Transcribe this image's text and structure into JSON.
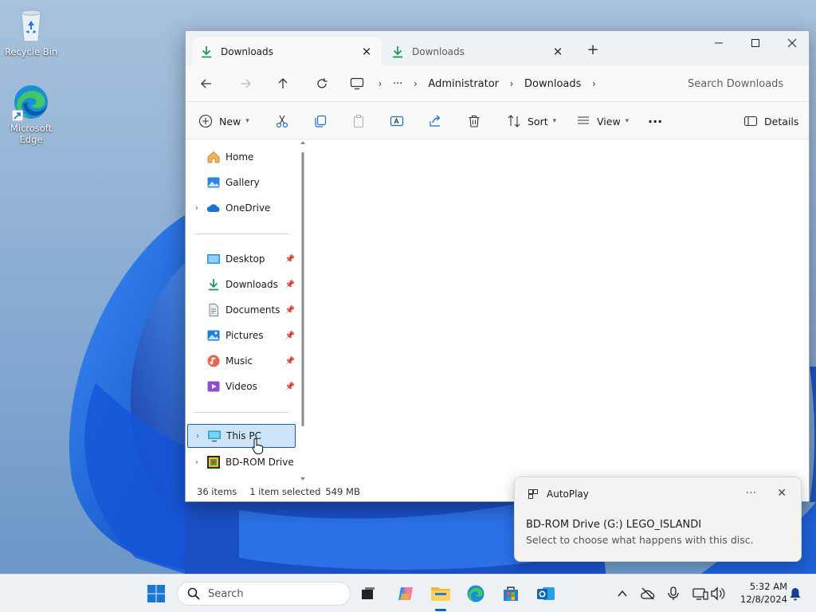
{
  "desktop": {
    "icons": [
      {
        "label": "Recycle Bin"
      },
      {
        "label": "Microsoft Edge"
      }
    ]
  },
  "explorer": {
    "tabs": [
      {
        "label": "Downloads",
        "active": true
      },
      {
        "label": "Downloads",
        "active": false
      }
    ],
    "address": {
      "ellipsis": "···",
      "crumbs": [
        "Administrator",
        "Downloads"
      ],
      "search_placeholder": "Search Downloads"
    },
    "commands": {
      "new": "New",
      "sort": "Sort",
      "view": "View",
      "more": "···",
      "details": "Details"
    },
    "nav": {
      "top": [
        "Home",
        "Gallery",
        "OneDrive"
      ],
      "quick_access": [
        "Desktop",
        "Downloads",
        "Documents",
        "Pictures",
        "Music",
        "Videos"
      ],
      "drives": [
        "This PC",
        "BD-ROM Drive ("
      ]
    },
    "status": {
      "items": "36 items",
      "selected": "1 item selected",
      "size": "549 MB"
    }
  },
  "toast": {
    "app": "AutoPlay",
    "more": "···",
    "title": "BD-ROM Drive (G:) LEGO_ISLANDI",
    "body": "Select to choose what happens with this disc."
  },
  "taskbar": {
    "search_placeholder": "Search",
    "time": "5:32 AM",
    "date": "12/8/2024"
  },
  "colors": {
    "accent": "#0067c0",
    "selection": "#cce4f7",
    "taskbar": "#edf1f6"
  }
}
